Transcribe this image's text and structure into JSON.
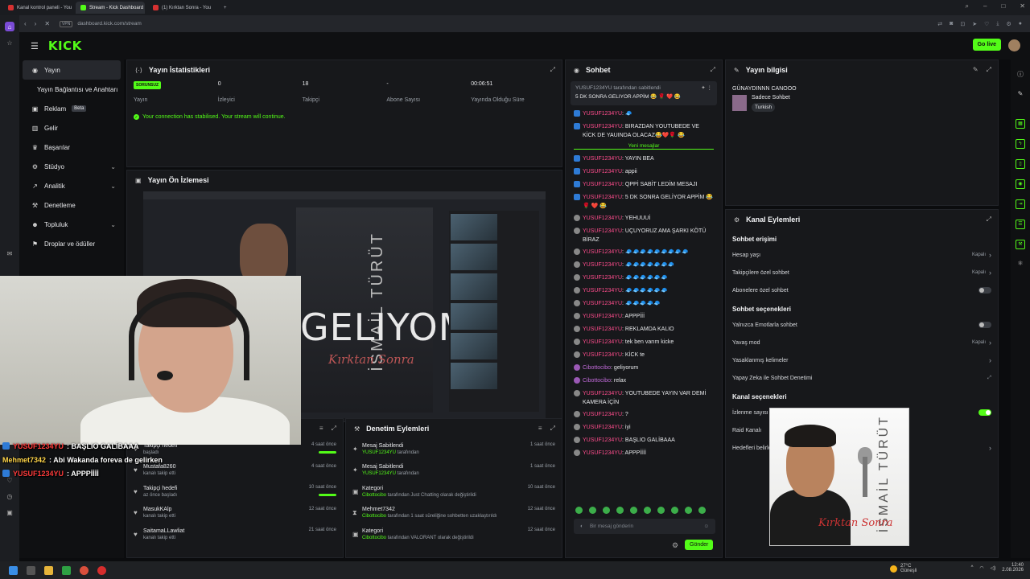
{
  "browser": {
    "tabs": [
      {
        "label": "Kanal kontrol paneli - You",
        "icon": "youtube-favicon"
      },
      {
        "label": "Stream - Kick Dashboard",
        "icon": "kick-favicon",
        "active": true
      },
      {
        "label": "(1) Kırktan Sonra - You",
        "icon": "youtube-favicon"
      }
    ],
    "url": "dashboard.kick.com/stream",
    "vpn": "VPN"
  },
  "header": {
    "logo": "KICK",
    "go_live": "Go live"
  },
  "sidebar": {
    "items": [
      {
        "label": "Yayın",
        "icon": "broadcast-icon",
        "active": true
      },
      {
        "label": "Yayın Bağlantısı ve Anahtarı",
        "icon": ""
      },
      {
        "label": "Reklam",
        "badge": "Beta",
        "icon": "ad-icon"
      },
      {
        "label": "Gelir",
        "icon": "money-icon"
      },
      {
        "label": "Başarılar",
        "icon": "trophy-icon"
      },
      {
        "label": "Stüdyo",
        "icon": "studio-icon",
        "chevron": true
      },
      {
        "label": "Analitik",
        "icon": "chart-icon",
        "chevron": true
      },
      {
        "label": "Denetleme",
        "icon": "hammer-icon"
      },
      {
        "label": "Topluluk",
        "icon": "people-icon",
        "chevron": true
      },
      {
        "label": "Droplar ve ödüller",
        "icon": "gift-icon"
      }
    ]
  },
  "stats_panel": {
    "title": "Yayın İstatistikleri",
    "status_badge": "SORUNSUZ",
    "stats": [
      {
        "value": "",
        "label": "Yayın"
      },
      {
        "value": "0",
        "label": "İzleyici"
      },
      {
        "value": "18",
        "label": "Takipçi"
      },
      {
        "value": "-",
        "label": "Abone Sayısı"
      },
      {
        "value": "00:06:51",
        "label": "Yayında Olduğu Süre"
      }
    ],
    "connection": "Your connection has stabilised. Your stream will continue."
  },
  "preview_panel": {
    "title": "Yayın Ön İzlemesi",
    "overlay_text": "GELIYOM",
    "album_artist": "İSMAİL TÜRÜT",
    "album_sign": "Kırktan Sonra"
  },
  "overlay_chat": [
    {
      "name": "YUSUF1234YU",
      "msg": ": BAŞLIO GALİBAAA",
      "color": "red",
      "badge": true
    },
    {
      "name": "Mehmet7342",
      "msg": ": Abi Wakanda foreva de gelirken",
      "color": "yellow",
      "badge": false
    },
    {
      "name": "YUSUF1234YU",
      "msg": ": APPPİİİİ",
      "color": "red",
      "badge": true
    }
  ],
  "activity_feed": {
    "items": [
      {
        "title": "Takipçi hedefi",
        "sub": "başladı",
        "when": "4 saat önce",
        "bar": true
      },
      {
        "title": "Mustafa8260",
        "sub": "kanalı takip etti",
        "when": "4 saat önce"
      },
      {
        "title": "Takipçi hedefi",
        "sub": "az önce başladı",
        "when": "10 saat önce",
        "bar": true
      },
      {
        "title": "MasukKAlp",
        "sub": "kanalı takip etti",
        "when": "12 saat önce"
      },
      {
        "title": "SaitamaLLawliat",
        "sub": "kanalı takip etti",
        "when": "21 saat önce"
      }
    ]
  },
  "moderation_panel": {
    "title": "Denetim Eylemleri",
    "items": [
      {
        "title": "Mesaj Sabitlendi",
        "actor": "YUSUF1234YU",
        "rest": " tarafından",
        "when": "1 saat önce",
        "icon": "pin-icon"
      },
      {
        "title": "Mesaj Sabitlendi",
        "actor": "YUSUF1234YU",
        "rest": " tarafından",
        "when": "1 saat önce",
        "icon": "pin-icon"
      },
      {
        "title": "Kategori",
        "actor": "Cibottocibo",
        "rest": " tarafından Just Chatting olarak değiştirildi",
        "when": "10 saat önce",
        "icon": "category-icon"
      },
      {
        "title": "Mehmet7342",
        "actor": "Cibottocibo",
        "rest": " tarafından 1 saat süreliğine sohbetten uzaklaştırıldı",
        "when": "12 saat önce",
        "icon": "hourglass-icon"
      },
      {
        "title": "Kategori",
        "actor": "Cibottocibo",
        "rest": " tarafından VALORANT olarak değiştirildi",
        "when": "12 saat önce",
        "icon": "category-icon"
      }
    ]
  },
  "chat_panel": {
    "title": "Sohbet",
    "pinned_by": "YUSUF1234YU tarafından sabitlendi",
    "pinned_msg": "5 DK SONRA GELIYOR APPİM 😂 🌹 ❤️ 😂",
    "new_messages": "Yeni mesajlar",
    "messages": [
      {
        "name": "YUSUF1234YU",
        "body": "🧢",
        "badge": "k"
      },
      {
        "name": "YUSUF1234YU",
        "body": "BIRAZDAN YOUTUBEDE VE KİCK DE YAUINDA OLACAZ😂❤️🌹 😂",
        "badge": "k"
      },
      {
        "sep": true
      },
      {
        "name": "YUSUF1234YU",
        "body": "YAYIN BEA",
        "badge": "k"
      },
      {
        "name": "YUSUF1234YU",
        "body": "appii",
        "badge": "k"
      },
      {
        "name": "YUSUF1234YU",
        "body": "QPPİ SABİT LEDİM MESAJI",
        "badge": "k"
      },
      {
        "name": "YUSUF1234YU",
        "body": "5 DK SONRA GELİYOR APPİM 😂 🌹 ❤️ 😂",
        "badge": "k"
      },
      {
        "name": "YUSUF1234YU",
        "body": "YEHUUUİ",
        "badge": "g"
      },
      {
        "name": "YUSUF1234YU",
        "body": "UÇUYORUZ AMA ŞARKI KÖTÜ BİRAZ",
        "badge": "g"
      },
      {
        "name": "YUSUF1234YU",
        "body": "🧢🧢🧢🧢🧢🧢🧢🧢🧢",
        "badge": "g"
      },
      {
        "name": "YUSUF1234YU",
        "body": "🧢🧢🧢🧢🧢🧢🧢",
        "badge": "g"
      },
      {
        "name": "YUSUF1234YU",
        "body": "🧢🧢🧢🧢🧢🧢",
        "badge": "g"
      },
      {
        "name": "YUSUF1234YU",
        "body": "🧢🧢🧢🧢🧢🧢",
        "badge": "g"
      },
      {
        "name": "YUSUF1234YU",
        "body": "🧢🧢🧢🧢🧢",
        "badge": "g"
      },
      {
        "name": "YUSUF1234YU",
        "body": "APPPİİİ",
        "badge": "g"
      },
      {
        "name": "YUSUF1234YU",
        "body": "REKLAMDA KALIO",
        "badge": "g"
      },
      {
        "name": "YUSUF1234YU",
        "body": "tek ben varım kicke",
        "badge": "g"
      },
      {
        "name": "YUSUF1234YU",
        "body": "KİCK te",
        "badge": "g"
      },
      {
        "name": "Cibottocibo",
        "body": "geliyorum",
        "badge": "p",
        "purple": true
      },
      {
        "name": "Cibottocibo",
        "body": "relax",
        "badge": "p",
        "purple": true
      },
      {
        "name": "YUSUF1234YU",
        "body": "YOUTUBEDE YAYIN VAR DEMİ KAMERA İÇİN",
        "badge": "g"
      },
      {
        "name": "YUSUF1234YU",
        "body": "?",
        "badge": "g"
      },
      {
        "name": "YUSUF1234YU",
        "body": "iyi",
        "badge": "g"
      },
      {
        "name": "YUSUF1234YU",
        "body": "BAŞLIO GALİBAAA",
        "badge": "g"
      },
      {
        "name": "YUSUF1234YU",
        "body": "APPPİİİİ",
        "badge": "g"
      }
    ],
    "input_placeholder": "Bir mesaj gönderin",
    "send": "Gönder"
  },
  "stream_info": {
    "title": "Yayın bilgisi",
    "stream_title": "GÜNAYDINNN CANOOO",
    "category": "Sadece Sohbet",
    "tag": "Turkish"
  },
  "channel_actions": {
    "title": "Kanal Eylemleri",
    "sections": [
      {
        "heading": "Sohbet erişimi",
        "rows": [
          {
            "label": "Hesap yaşı",
            "value": "Kapalı",
            "type": "chevron"
          },
          {
            "label": "Takipçilere özel sohbet",
            "value": "Kapalı",
            "type": "chevron"
          },
          {
            "label": "Abonelere özel sohbet",
            "value": "",
            "type": "toggle-off"
          }
        ]
      },
      {
        "heading": "Sohbet seçenekleri",
        "rows": [
          {
            "label": "Yalnızca Emotlarla sohbet",
            "value": "",
            "type": "toggle-off"
          },
          {
            "label": "Yavaş mod",
            "value": "Kapalı",
            "type": "chevron"
          },
          {
            "label": "Yasaklanmış kelimeler",
            "value": "",
            "type": "chevron"
          },
          {
            "label": "Yapay Zeka ile Sohbet Denetimi",
            "value": "",
            "type": "external"
          }
        ]
      },
      {
        "heading": "Kanal seçenekleri",
        "rows": [
          {
            "label": "İzlenme sayısı göster",
            "value": "",
            "type": "toggle-on"
          },
          {
            "label": "Raid Kanalı",
            "value": "",
            "type": "none"
          },
          {
            "label": "Hedefleri belirle",
            "value": "",
            "type": "chevron"
          }
        ]
      }
    ],
    "album_artist": "İSMAİL TÜRÜT",
    "album_sign": "Kırktan Sonra"
  },
  "taskbar": {
    "temp": "27°C",
    "weather": "Güneşli",
    "time": "12:40",
    "date": "2.08.2026"
  },
  "colors": {
    "accent": "#53fc18",
    "chat_name": "#ff4d8d",
    "bg": "#0b0c0e",
    "panel": "#17181b"
  }
}
